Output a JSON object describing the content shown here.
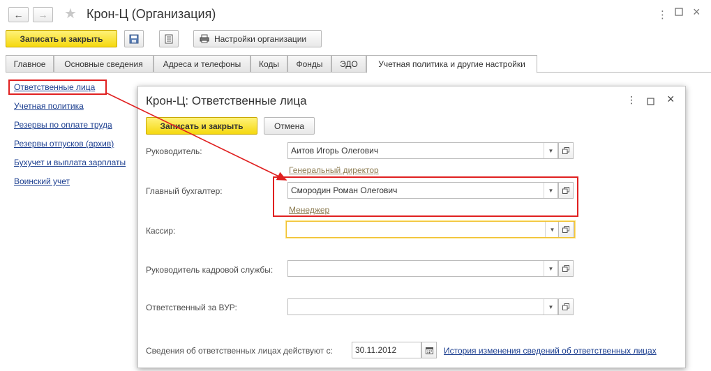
{
  "window": {
    "title": "Крон-Ц (Организация)",
    "menu_icon": "more-vertical-icon",
    "maximize_icon": "maximize-icon",
    "close_icon": "close-icon"
  },
  "toolbar": {
    "save_close_label": "Записать и закрыть",
    "settings_label": "Настройки организации"
  },
  "tabs": [
    {
      "label": "Главное"
    },
    {
      "label": "Основные сведения"
    },
    {
      "label": "Адреса и телефоны"
    },
    {
      "label": "Коды"
    },
    {
      "label": "Фонды"
    },
    {
      "label": "ЭДО"
    },
    {
      "label": "Учетная политика и другие настройки"
    }
  ],
  "sidebar": {
    "items": [
      {
        "label": "Ответственные лица"
      },
      {
        "label": "Учетная политика"
      },
      {
        "label": "Резервы по оплате труда"
      },
      {
        "label": "Резервы отпусков (архив)"
      },
      {
        "label": "Бухучет и выплата зарплаты"
      },
      {
        "label": "Воинский учет"
      }
    ]
  },
  "dialog": {
    "title": "Крон-Ц: Ответственные лица",
    "save_close_label": "Записать и закрыть",
    "cancel_label": "Отмена",
    "fields": {
      "head": {
        "label": "Руководитель:",
        "value": "Аитов Игорь Олегович",
        "position": "Генеральный директор"
      },
      "chief_accountant": {
        "label": "Главный бухгалтер:",
        "value": "Смородин Роман Олегович",
        "position": "Менеджер"
      },
      "cashier": {
        "label": "Кассир:",
        "value": ""
      },
      "hr_head": {
        "label": "Руководитель кадровой службы:",
        "value": ""
      },
      "vur": {
        "label": "Ответственный за ВУР:",
        "value": ""
      }
    },
    "effective": {
      "label": "Сведения об ответственных лицах действуют с:",
      "date": "30.11.2012",
      "history_link": "История изменения сведений об ответственных лицах"
    }
  },
  "colors": {
    "accent_yellow": "#f5d80f",
    "highlight_red": "#e02020",
    "link_blue": "#1a3d8f"
  }
}
